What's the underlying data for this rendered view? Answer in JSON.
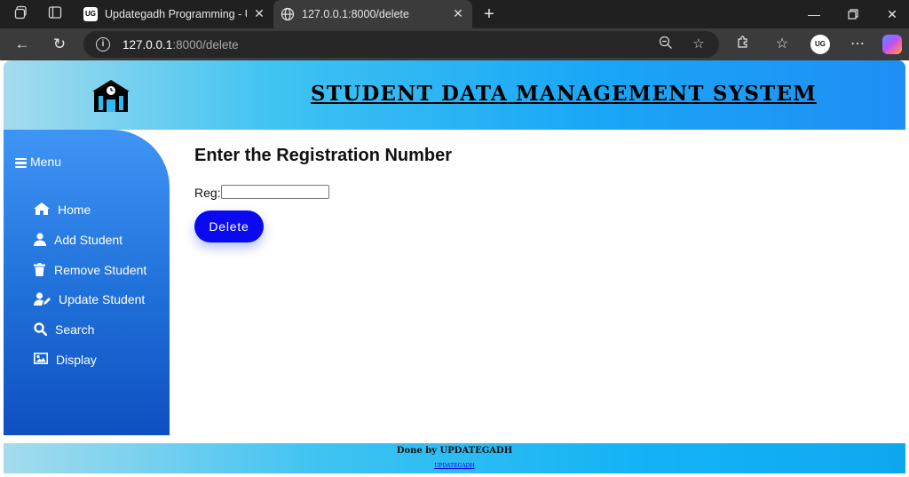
{
  "browser": {
    "tabs": [
      {
        "title": "Updategadh Programming - Upd",
        "favicon": "UG",
        "active": false
      },
      {
        "title": "127.0.0.1:8000/delete",
        "favicon": "globe-icon",
        "active": true
      }
    ],
    "url_host": "127.0.0.1",
    "url_rest": ":8000/delete",
    "profile_initials": "UG"
  },
  "header": {
    "title": "STUDENT DATA MANAGEMENT SYSTEM"
  },
  "sidebar": {
    "menu_label": "Menu",
    "items": [
      {
        "label": "Home",
        "icon": "home-icon"
      },
      {
        "label": "Add Student",
        "icon": "user-icon"
      },
      {
        "label": "Remove Student",
        "icon": "trash-icon"
      },
      {
        "label": "Update Student",
        "icon": "user-edit-icon"
      },
      {
        "label": "Search",
        "icon": "search-icon"
      },
      {
        "label": "Display",
        "icon": "image-icon"
      }
    ]
  },
  "main": {
    "heading": "Enter the Registration Number",
    "reg_label": "Reg:",
    "reg_value": "",
    "delete_label": "Delete"
  },
  "footer": {
    "done_text": "Done by UPDATEGADH",
    "link_text": "UPDATEGADH"
  },
  "colors": {
    "header_gradient_start": "#a5dced",
    "header_gradient_end": "#1f8ef5",
    "sidebar_top": "#3f95f5",
    "sidebar_bottom": "#0f4fc2",
    "delete_button": "#0a0af0"
  }
}
